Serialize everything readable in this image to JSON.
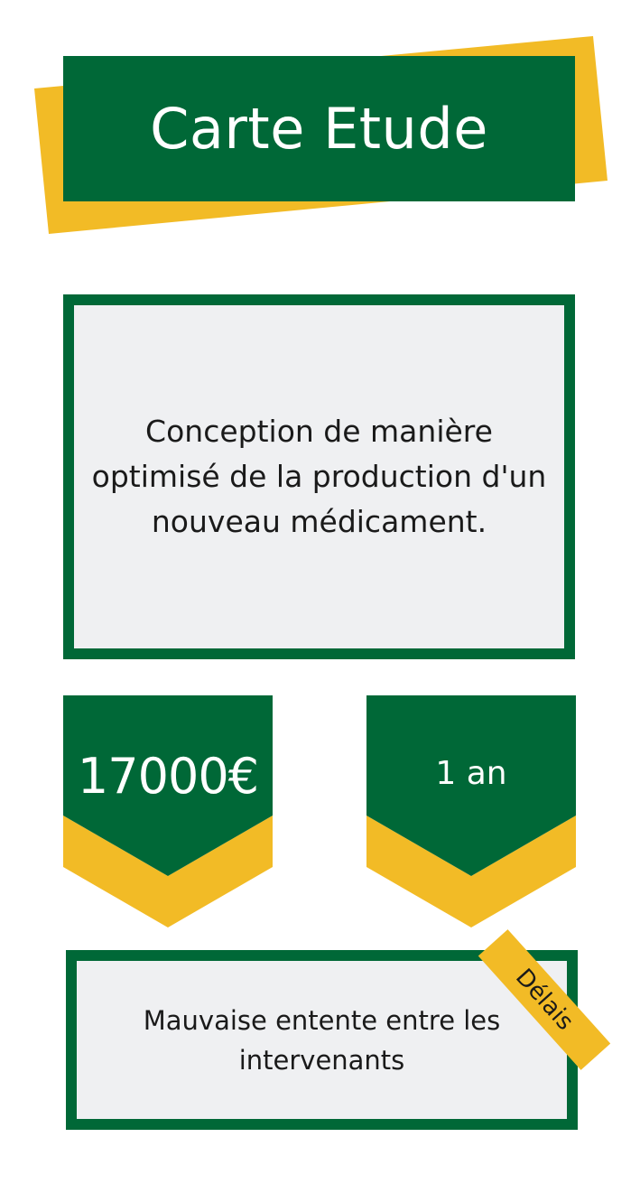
{
  "colors": {
    "green": "#006837",
    "yellow": "#f2bb26",
    "panel": "#eff0f2"
  },
  "title": "Carte Etude",
  "description": "Conception de manière optimisé de la production d'un nouveau médicament.",
  "budget": "17000€",
  "duration": "1 an",
  "risk": "Mauvaise entente entre les intervenants",
  "risk_tag": "Délais"
}
